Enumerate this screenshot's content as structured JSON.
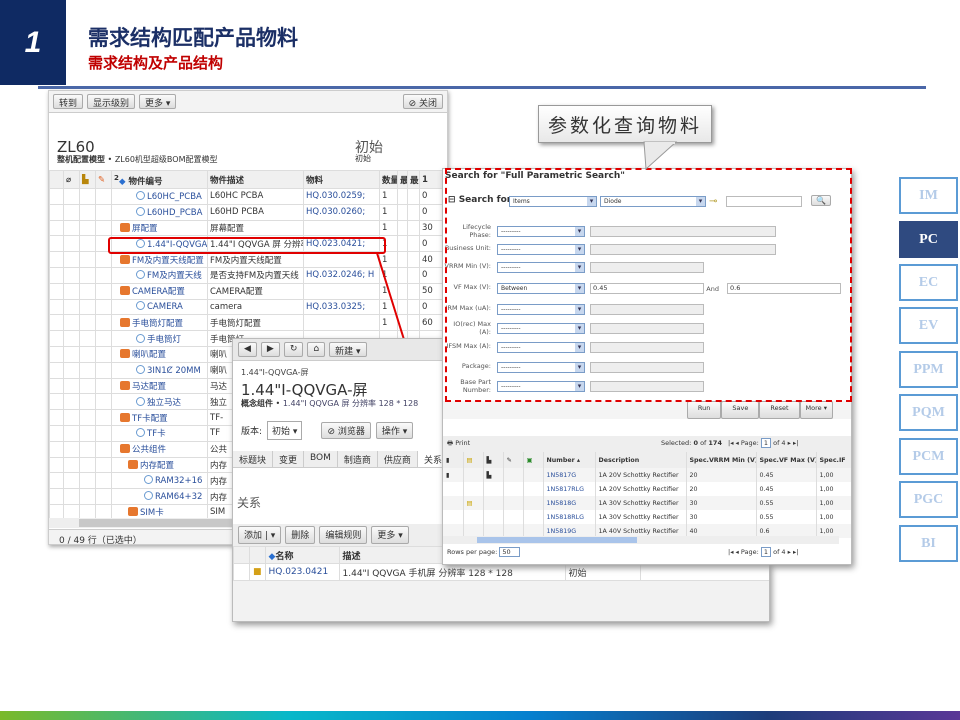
{
  "slide": {
    "number": "1",
    "title": "需求结构匹配产品物料",
    "subtitle": "需求结构及产品结构"
  },
  "callout": "参数化查询物料",
  "nav": [
    {
      "label": "IM",
      "active": false
    },
    {
      "label": "PC",
      "active": true
    },
    {
      "label": "EC",
      "active": false
    },
    {
      "label": "EV",
      "active": false
    },
    {
      "label": "PPM",
      "active": false
    },
    {
      "label": "PQM",
      "active": false
    },
    {
      "label": "PCM",
      "active": false
    },
    {
      "label": "PGC",
      "active": false
    },
    {
      "label": "BI",
      "active": false
    }
  ],
  "bom": {
    "toolbar": {
      "goto": "转到",
      "show_level": "显示级别",
      "more": "更多",
      "close": "关闭"
    },
    "name": "ZL60",
    "type": "整机配置模型",
    "desc": "ZL60机型超级BOM配置模型",
    "state": "初始",
    "state_small": "初始",
    "columns": {
      "sort": "2",
      "number": "物件编号",
      "desc": "物件描述",
      "material": "物料",
      "qty": "数量",
      "c2": "最",
      "c3": "最:",
      "c4": "1"
    },
    "rows": [
      {
        "icon": "part",
        "level": 1,
        "number": "L60HC_PCBA",
        "desc": "L60HC PCBA",
        "material": "HQ.030.0259;",
        "qty": "1",
        "v": "0"
      },
      {
        "icon": "part",
        "level": 1,
        "number": "L60HD_PCBA",
        "desc": "L60HD PCBA",
        "material": "HQ.030.0260;",
        "qty": "1",
        "v": "0"
      },
      {
        "icon": "config",
        "level": 0,
        "number": "屏配置",
        "desc": "屏幕配置",
        "material": "",
        "qty": "1",
        "v": "30"
      },
      {
        "icon": "part",
        "level": 1,
        "number": "1.44\"I-QQVGA-屏",
        "desc": "1.44\"I QQVGA 屏 分辨率",
        "material": "HQ.023.0421;",
        "qty": "1",
        "v": "0",
        "highlight": true
      },
      {
        "icon": "config",
        "level": 0,
        "number": "FM及内置天线配置",
        "desc": "FM及内置天线配置",
        "material": "",
        "qty": "1",
        "v": "40"
      },
      {
        "icon": "part",
        "level": 1,
        "number": "FM及内置天线",
        "desc": "是否支持FM及内置天线",
        "material": "HQ.032.0246; H",
        "qty": "1",
        "v": "0"
      },
      {
        "icon": "config",
        "level": 0,
        "number": "CAMERA配置",
        "desc": "CAMERA配置",
        "material": "",
        "qty": "1",
        "v": "50"
      },
      {
        "icon": "part",
        "level": 1,
        "number": "CAMERA",
        "desc": "camera",
        "material": "HQ.033.0325;",
        "qty": "1",
        "v": "0"
      },
      {
        "icon": "config",
        "level": 0,
        "number": "手电筒灯配置",
        "desc": "手电筒灯配置",
        "material": "",
        "qty": "1",
        "v": "60"
      },
      {
        "icon": "part",
        "level": 1,
        "number": "手电筒灯",
        "desc": "手电筒灯",
        "material": "",
        "qty": "",
        "v": ""
      },
      {
        "icon": "config",
        "level": 0,
        "number": "喇叭配置",
        "desc": "喇叭",
        "material": "",
        "qty": "",
        "v": ""
      },
      {
        "icon": "part",
        "level": 1,
        "number": "3IN1Ȼ 20MM",
        "desc": "喇叭",
        "material": "",
        "qty": "",
        "v": ""
      },
      {
        "icon": "config",
        "level": 0,
        "number": "马达配置",
        "desc": "马达",
        "material": "",
        "qty": "",
        "v": ""
      },
      {
        "icon": "part",
        "level": 1,
        "number": "独立马达",
        "desc": "独立",
        "material": "",
        "qty": "",
        "v": ""
      },
      {
        "icon": "config",
        "level": 0,
        "number": "TF卡配置",
        "desc": "TF-",
        "material": "",
        "qty": "",
        "v": ""
      },
      {
        "icon": "part",
        "level": 1,
        "number": "TF卡",
        "desc": "TF",
        "material": "",
        "qty": "",
        "v": ""
      },
      {
        "icon": "config",
        "level": 0,
        "number": "公共组件",
        "desc": "公共",
        "material": "",
        "qty": "",
        "v": ""
      },
      {
        "icon": "config",
        "level": 1,
        "number": "内存配置",
        "desc": "内存",
        "material": "",
        "qty": "",
        "v": ""
      },
      {
        "icon": "part",
        "level": 2,
        "number": "RAM32+16",
        "desc": "内存",
        "material": "",
        "qty": "",
        "v": ""
      },
      {
        "icon": "part",
        "level": 2,
        "number": "RAM64+32",
        "desc": "内存",
        "material": "",
        "qty": "",
        "v": ""
      },
      {
        "icon": "config",
        "level": 1,
        "number": "SIM卡",
        "desc": "SIM",
        "material": "",
        "qty": "",
        "v": ""
      }
    ],
    "status": "0 / 49 行（已选中）"
  },
  "item": {
    "toolbar": {
      "new": "新建"
    },
    "breadcrumb": "1.44\"I-QQVGA-屏",
    "title": "1.44\"I-QQVGA-屏",
    "type": "概念组件",
    "desc": "1.44\"I QQVGA 屏 分辨率 128 * 128",
    "version_label": "版本:",
    "version": "初始",
    "browser": "浏览器",
    "actions": "操作",
    "tabs": [
      "标题块",
      "变更",
      "BOM",
      "制造商",
      "供应商",
      "关系"
    ],
    "section": "关系",
    "buttons": {
      "add": "添加",
      "delete": "删除",
      "edit_rule": "编辑规则",
      "more": "更多"
    },
    "columns": {
      "name": "名称",
      "desc": "描述"
    },
    "row": {
      "name": "HQ.023.0421",
      "desc": "1.44\"I QQVGA 手机屏 分辨率 128 * 128",
      "state": "初始"
    }
  },
  "search": {
    "title": "Search for \"Full Parametric Search\"",
    "search_for": "Search for",
    "class1": "Items",
    "class2": "Diode",
    "fields": [
      {
        "label": "Lifecycle Phase:",
        "op": "---------",
        "value": null,
        "dropdown": true
      },
      {
        "label": "Business Unit:",
        "op": "---------",
        "value": null,
        "dropdown": true
      },
      {
        "label": "VRRM Min (V):",
        "op": "---------",
        "value": null
      },
      {
        "label": "VF Max (V):",
        "op": "Between",
        "value": "0.45",
        "and_label": "And",
        "and_value": "0.6"
      },
      {
        "label": "IRM Max (uA):",
        "op": "---------",
        "value": null
      },
      {
        "label": "IO(rec) Max (A):",
        "op": "---------",
        "value": null
      },
      {
        "label": "IFSM Max (A):",
        "op": "---------",
        "value": null
      },
      {
        "label": "Package:",
        "op": "---------",
        "value": null
      },
      {
        "label": "Base Part Number:",
        "op": "---------",
        "value": null
      }
    ],
    "buttons": {
      "run": "Run",
      "save": "Save",
      "reset": "Reset",
      "more": "More"
    },
    "print": "Print",
    "selected_label": "Selected:",
    "selected": "0",
    "of_label": "of",
    "total": "174",
    "page_label": "Page:",
    "page": "1",
    "pages_text": "of 4",
    "columns": [
      "Number",
      "Description",
      "Spec.VRRM Min (V)",
      "Spec.VF Max (V)",
      "Spec.IF"
    ],
    "rows": [
      {
        "number": "1N5817G",
        "desc": "1A 20V Schottky Rectifier",
        "vrrm": "20",
        "vf": "0.45",
        "if": "1,00",
        "att": true,
        "mfr": true
      },
      {
        "number": "1N5817RLG",
        "desc": "1A 20V Schottky Rectifier",
        "vrrm": "20",
        "vf": "0.45",
        "if": "1,00"
      },
      {
        "number": "1N5818G",
        "desc": "1A 30V Schottky Rectifier",
        "vrrm": "30",
        "vf": "0.55",
        "if": "1,00",
        "doc": true
      },
      {
        "number": "1N5818RLG",
        "desc": "1A 30V Schottky Rectifier",
        "vrrm": "30",
        "vf": "0.55",
        "if": "1,00"
      },
      {
        "number": "1N5819G",
        "desc": "1A 40V Schottky Rectifier",
        "vrrm": "40",
        "vf": "0.6",
        "if": "1,00"
      }
    ],
    "rows_per_page_label": "Rows per page:",
    "rows_per_page": "50"
  },
  "colors": {
    "navy": "#0f2a63",
    "red": "#c00000",
    "nav_active": "#2f4a80",
    "nav_border": "#5b9bd5",
    "highlight": "#e00000"
  }
}
